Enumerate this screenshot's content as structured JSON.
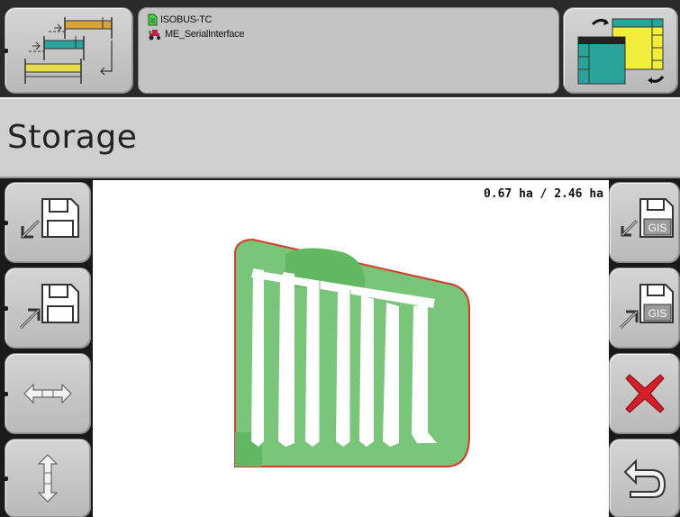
{
  "header": {
    "device_name": "ISOBUS-TC",
    "implement_name": "ME_SerialInterface"
  },
  "page": {
    "title": "Storage"
  },
  "map": {
    "area_readout": "0.67 ha / 2.46 ha",
    "colors": {
      "coverage": "#72c472",
      "boundary": "#d63a2a",
      "background": "#ffffff"
    }
  },
  "left_toolbar": {
    "items": [
      {
        "icon": "import-from-disk-icon"
      },
      {
        "icon": "export-to-disk-icon"
      },
      {
        "icon": "move-horizontal-icon"
      },
      {
        "icon": "move-vertical-icon"
      }
    ]
  },
  "right_toolbar": {
    "items": [
      {
        "icon": "import-gis-icon",
        "badge": "GIS"
      },
      {
        "icon": "export-gis-icon",
        "badge": "GIS"
      },
      {
        "icon": "cancel-icon"
      },
      {
        "icon": "back-icon"
      }
    ]
  }
}
